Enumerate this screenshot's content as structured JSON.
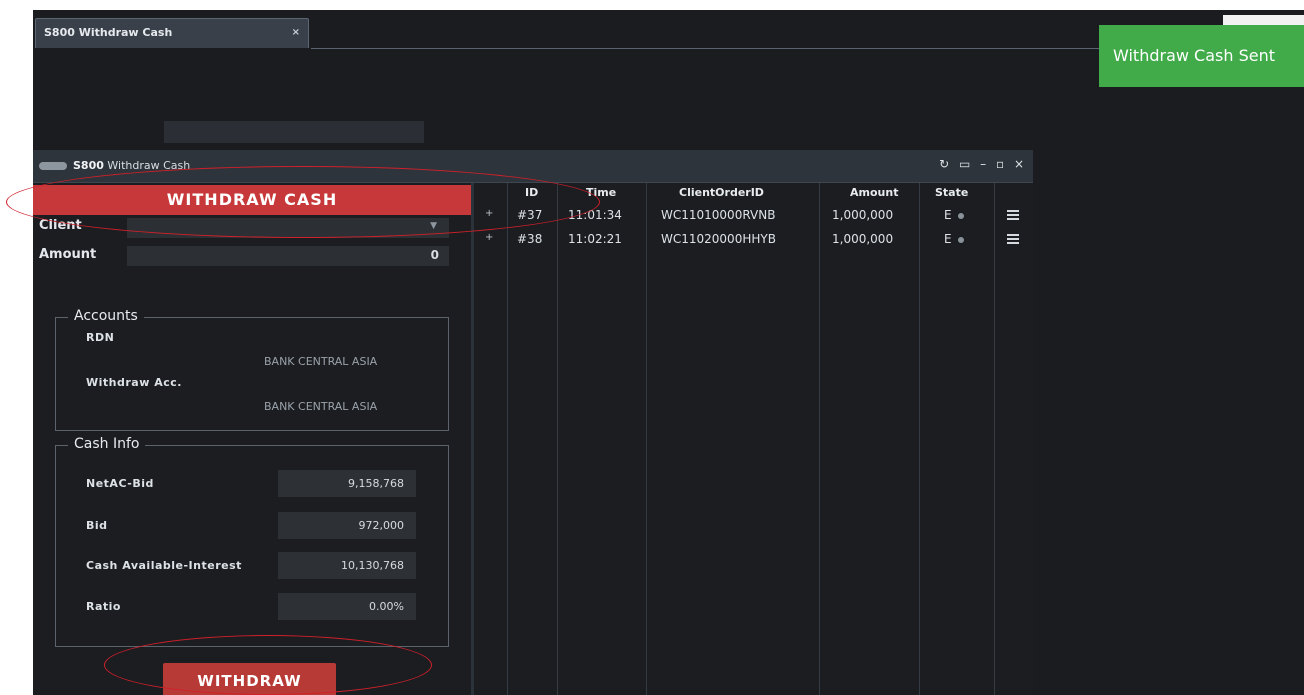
{
  "tab": {
    "title": "S800 Withdraw Cash",
    "close": "×"
  },
  "toast": {
    "message": "Withdraw Cash Sent"
  },
  "window": {
    "code": "S800",
    "title": "Withdraw Cash",
    "controls": "↻ ▭ – ▫ ×"
  },
  "form": {
    "banner": "WITHDRAW CASH",
    "client_label": "Client",
    "client_value": "",
    "amount_label": "Amount",
    "amount_value": "0",
    "accounts": {
      "legend": "Accounts",
      "rdn_label": "RDN",
      "rdn_bank": "BANK CENTRAL ASIA",
      "withdraw_label": "Withdraw Acc.",
      "withdraw_bank": "BANK CENTRAL ASIA"
    },
    "cash_info": {
      "legend": "Cash Info",
      "rows": [
        {
          "label": "NetAC-Bid",
          "value": "9,158,768"
        },
        {
          "label": "Bid",
          "value": "972,000"
        },
        {
          "label": "Cash Available-Interest",
          "value": "10,130,768"
        },
        {
          "label": "Ratio",
          "value": "0.00%"
        }
      ]
    },
    "submit_label": "WITHDRAW"
  },
  "table": {
    "headers": [
      "ID",
      "Time",
      "ClientOrderID",
      "Amount",
      "State"
    ],
    "rows": [
      {
        "expand": "+",
        "id": "#37",
        "time": "11:01:34",
        "client_order_id": "WC11010000RVNB",
        "amount": "1,000,000",
        "state": "E"
      },
      {
        "expand": "+",
        "id": "#38",
        "time": "11:02:21",
        "client_order_id": "WC11020000HHYB",
        "amount": "1,000,000",
        "state": "E"
      }
    ]
  },
  "colors": {
    "accent_red": "#c6383a",
    "toast_green": "#41ab4a",
    "annotation_red": "#d0202a"
  }
}
